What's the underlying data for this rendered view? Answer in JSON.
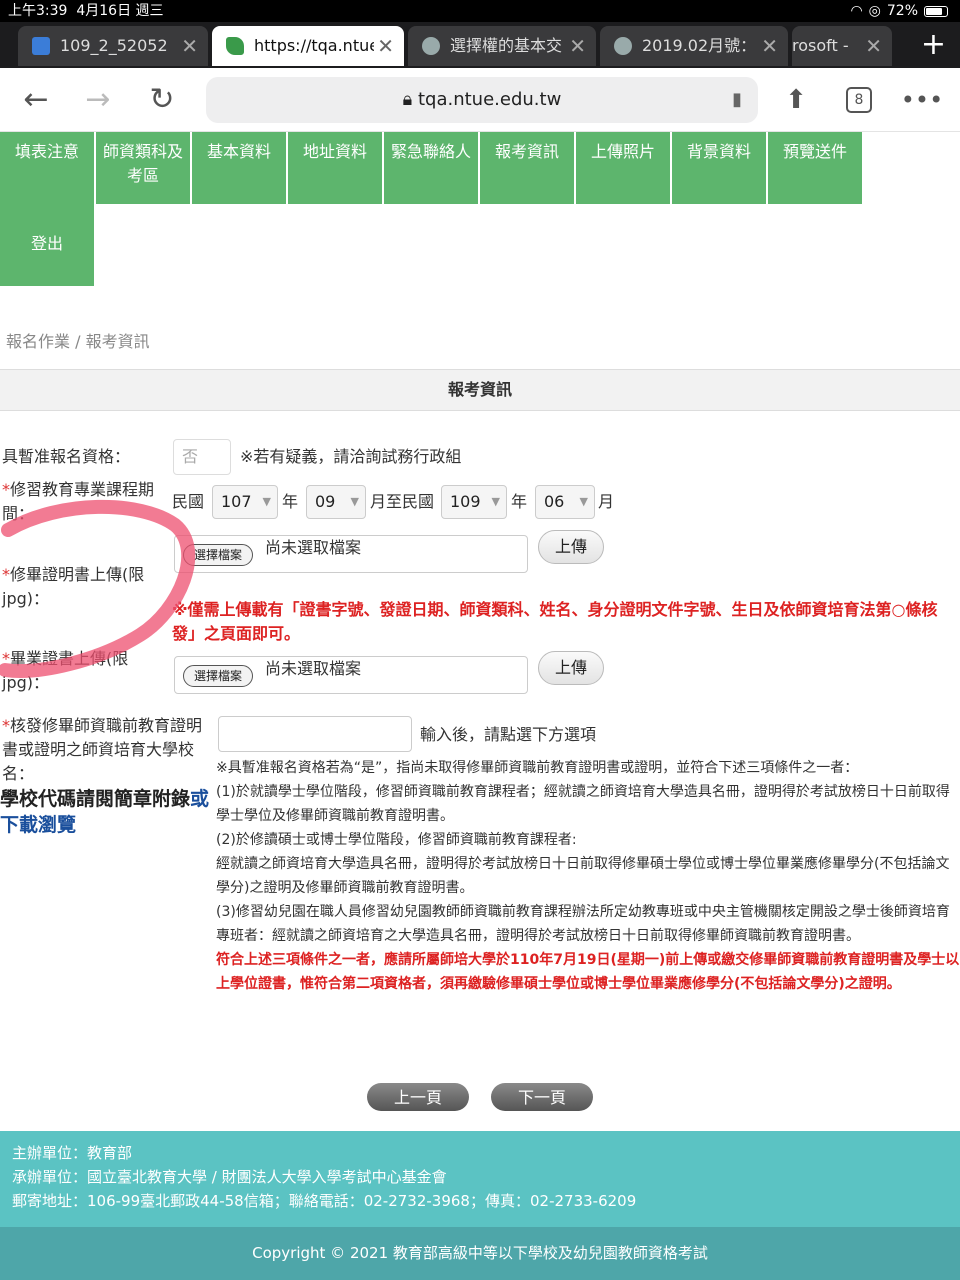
{
  "status": {
    "time": "上午3:39",
    "date": "4月16日 週三",
    "battery": "72%"
  },
  "tabs": [
    {
      "label": "109_2_52052",
      "active": false
    },
    {
      "label": "https://tqa.ntue",
      "active": true
    },
    {
      "label": "選擇權的基本交",
      "active": false
    },
    {
      "label": "2019.02月號：",
      "active": false
    },
    {
      "label": "rosoft -",
      "active": false
    }
  ],
  "toolbar": {
    "url": "tqa.ntue.edu.tw",
    "tab_count": "8"
  },
  "nav": [
    "填表注意",
    "師資類科及考區",
    "基本資料",
    "地址資料",
    "緊急聯絡人",
    "報考資訊",
    "上傳照片",
    "背景資料",
    "預覽送件",
    "登出"
  ],
  "breadcrumb": "報名作業 / 報考資訊",
  "section_title": "報考資訊",
  "form": {
    "q1": {
      "label": "具暫准報名資格：",
      "value": "否",
      "note": "※若有疑義，請洽詢試務行政組"
    },
    "q2": {
      "label": "修習教育專業課程期間：",
      "prefix": "民國",
      "y1": "107",
      "ylbl": "年",
      "m1": "09",
      "mid": "月至民國",
      "y2": "109",
      "m2": "06",
      "mlbl": "月"
    },
    "q3": {
      "label": "修畢證明書上傳(限jpg)：",
      "choose": "選擇檔案",
      "nofile": "尚未選取檔案",
      "upload": "上傳"
    },
    "warning": "※僅需上傳載有「證書字號、發證日期、師資類科、姓名、身分證明文件字號、生日及依師資培育法第○條核發」之頁面即可。",
    "q4": {
      "label": "畢業證書上傳(限jpg)：",
      "choose": "選擇檔案",
      "nofile": "尚未選取檔案",
      "upload": "上傳"
    },
    "q5": {
      "label": "核發修畢師資職前教育證明書或證明之師資培育大學校名：",
      "hint": "輸入後，請點選下方選項",
      "link_pre": "學校代碼請閱簡章附錄",
      "link_text": "或下載瀏覽"
    }
  },
  "notes": [
    "※具暫准報名資格若為“是”，指尚未取得修畢師資職前教育證明書或證明，並符合下述三項條件之一者：",
    "(1)於就讀學士學位階段，修習師資職前教育課程者；經就讀之師資培育大學造具名冊，證明得於考試放榜日十日前取得學士學位及修畢師資職前教育證明書。",
    "(2)於修讀碩士或博士學位階段，修習師資職前教育課程者:",
    "經就讀之師資培育大學造具名冊，證明得於考試放榜日十日前取得修畢碩士學位或博士學位畢業應修畢學分(不包括論文學分)之證明及修畢師資職前教育證明書。",
    "(3)修習幼兒園在職人員修習幼兒園教師師資職前教育課程辦法所定幼教專班或中央主管機關核定開設之學士後師資培育專班者：經就讀之師資培育之大學造具名冊，證明得於考試放榜日十日前取得修畢師資職前教育證明書。"
  ],
  "notes_red": "符合上述三項條件之一者，應請所屬師培大學於110年7月19日(星期一)前上傳或繳交修畢師資職前教育證明書及學士以上學位證書，惟符合第二項資格者，須再繳驗修畢碩士學位或博士學位畢業應修學分(不包括論文學分)之證明。",
  "buttons": {
    "prev": "上一頁",
    "next": "下一頁"
  },
  "footer": {
    "line1": "主辦單位：教育部",
    "line2": "承辦單位：國立臺北教育大學 / 財團法人大學入學考試中心基金會",
    "line3": "郵寄地址：106-99臺北郵政44-58信箱；聯絡電話：02-2732-3968；傳真：02-2733-6209",
    "copyright": "Copyright © 2021 教育部高級中等以下學校及幼兒園教師資格考試"
  },
  "colors": {
    "nav_green": "#5db56d",
    "footer_teal": "#5bc3c3",
    "warning_red": "#d22222",
    "annotation_pink": "#ee4f6f"
  }
}
